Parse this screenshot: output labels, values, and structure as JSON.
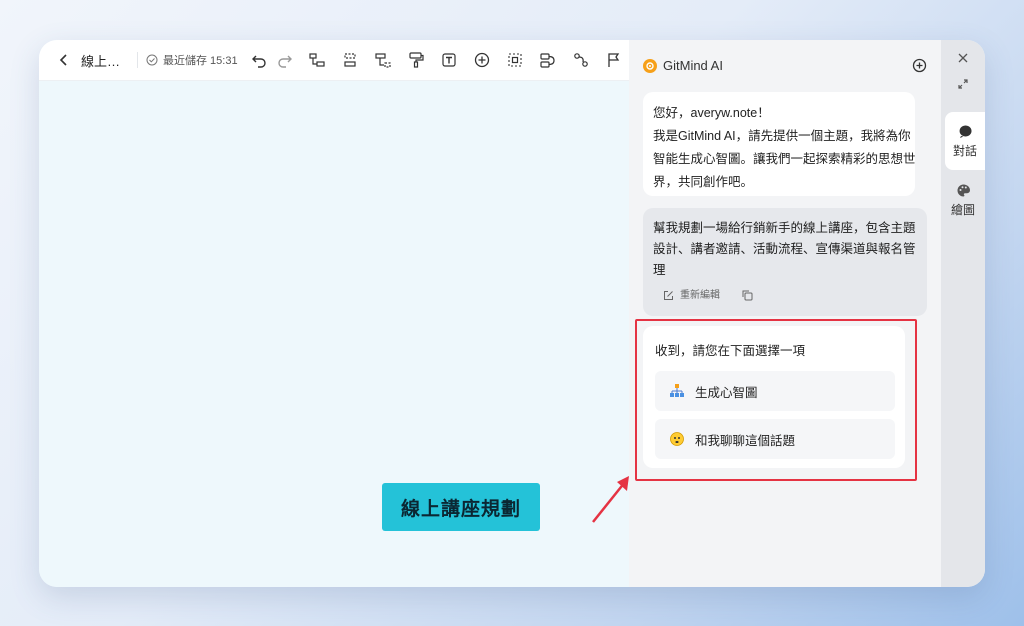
{
  "toolbar": {
    "title": "線上…",
    "save_status": "最近儲存 15:31",
    "tools": [
      "add-child-icon",
      "add-sibling-icon",
      "add-parent-icon",
      "format-painter-icon",
      "text-icon",
      "insert-icon",
      "select-icon",
      "relation-icon",
      "summary-icon",
      "flag-icon"
    ]
  },
  "canvas": {
    "central_node": "線上講座規劃"
  },
  "ai_panel": {
    "title": "GitMind AI",
    "greeting_lines": [
      "您好，averyw.note！",
      "我是GitMind AI，請先提供一個主題，我將為你",
      "智能生成心智圖。讓我們一起探索精彩的思想世",
      "界，共同創作吧。"
    ],
    "user_message_lines": [
      "幫我規劃一場給行銷新手的線上講座，包含主題",
      "設計、講者邀請、活動流程、宣傳渠道與報名管",
      "理"
    ],
    "re_edit_label": "重新編輯",
    "reply_prompt": "收到，請您在下面選擇一項",
    "options": [
      {
        "label": "生成心智圖",
        "icon": "org-chart-icon"
      },
      {
        "label": "和我聊聊這個話題",
        "icon": "emoji-icon"
      }
    ]
  },
  "rail": {
    "chat_label": "對話",
    "draw_label": "繪圖"
  },
  "colors": {
    "node": "#24c2d8",
    "highlight": "#e53343",
    "ai_logo": "#f6a019"
  }
}
